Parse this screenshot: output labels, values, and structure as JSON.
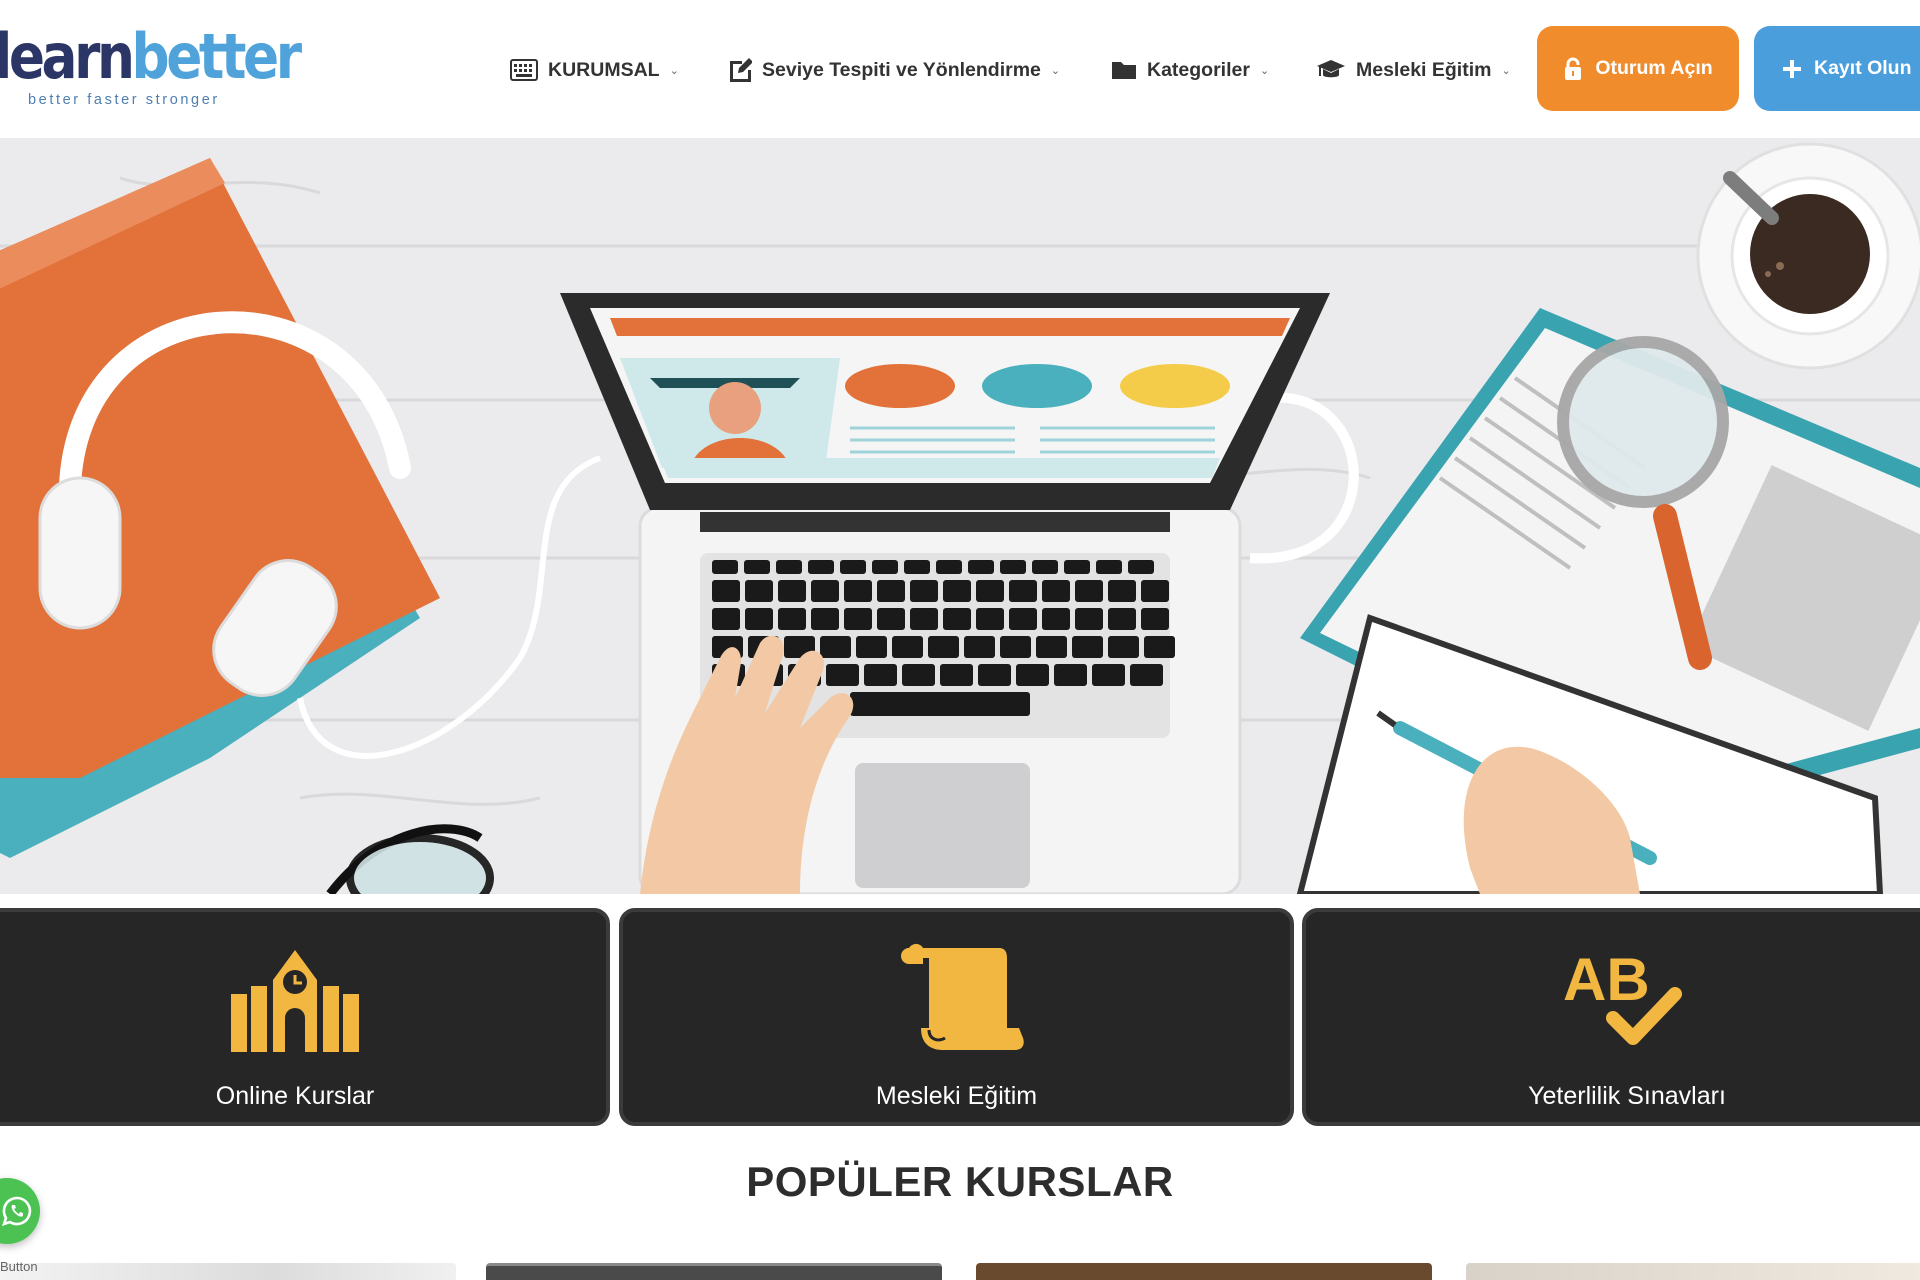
{
  "brand": {
    "name_part1": "learn",
    "name_part2": "better",
    "tagline": "better faster stronger"
  },
  "nav": {
    "items": [
      {
        "label": "KURUMSAL",
        "icon": "keyboard-icon"
      },
      {
        "label": "Seviye Tespiti ve Yönlendirme",
        "icon": "edit-icon"
      },
      {
        "label": "Kategoriler",
        "icon": "folder-icon"
      },
      {
        "label": "Mesleki Eğitim",
        "icon": "graduation-cap-icon"
      }
    ],
    "login_label": "Oturum Açın",
    "signup_label": "Kayıt Olun"
  },
  "colors": {
    "login_button": "#f08c2b",
    "signup_button": "#4a9edc",
    "card_background": "#262626",
    "card_icon": "#f2b740",
    "logo_dark": "#2b3566",
    "logo_light": "#4fa3da"
  },
  "categories": [
    {
      "title": "Online Kurslar",
      "icon": "school-building-icon"
    },
    {
      "title": "Mesleki Eğitim",
      "icon": "scroll-icon"
    },
    {
      "title": "Yeterlilik Sınavları",
      "icon": "ab-check-icon"
    }
  ],
  "popular": {
    "title": "POPÜLER KURSLAR"
  },
  "whatsapp": {
    "label": "Button"
  }
}
